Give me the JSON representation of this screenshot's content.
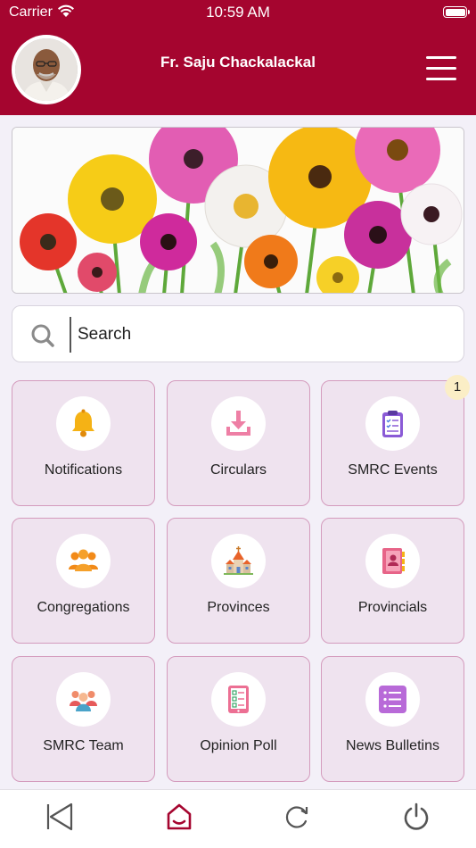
{
  "status_bar": {
    "carrier": "Carrier",
    "time": "10:59 AM"
  },
  "header": {
    "title": "Fr. Saju Chackalackal",
    "background_color": "#a5052f"
  },
  "search": {
    "placeholder": "Search"
  },
  "menu_tiles": [
    {
      "label": "Notifications",
      "icon": "bell-icon"
    },
    {
      "label": "Circulars",
      "icon": "download-icon"
    },
    {
      "label": "SMRC Events",
      "icon": "clipboard-checklist-icon",
      "badge": "1"
    },
    {
      "label": "Congregations",
      "icon": "group-icon"
    },
    {
      "label": "Provinces",
      "icon": "church-icon"
    },
    {
      "label": "Provincials",
      "icon": "contact-book-icon"
    },
    {
      "label": "SMRC Team",
      "icon": "team-icon"
    },
    {
      "label": "Opinion Poll",
      "icon": "tablet-poll-icon"
    },
    {
      "label": "News Bulletins",
      "icon": "list-icon"
    }
  ],
  "bottom_bar": [
    {
      "icon": "back-icon"
    },
    {
      "icon": "home-icon",
      "active": true
    },
    {
      "icon": "refresh-icon"
    },
    {
      "icon": "power-icon"
    }
  ],
  "colors": {
    "accent": "#a5052f",
    "tile_background": "#efe3ef",
    "tile_border": "#d49bbd"
  }
}
